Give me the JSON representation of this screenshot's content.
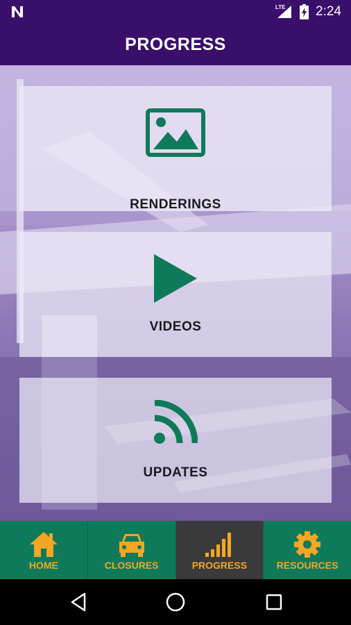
{
  "status_bar": {
    "network_label": "LTE",
    "time": "2:24"
  },
  "app_bar": {
    "title": "PROGRESS"
  },
  "cards": [
    {
      "label": "RENDERINGS",
      "icon": "image-icon"
    },
    {
      "label": "VIDEOS",
      "icon": "play-icon"
    },
    {
      "label": "UPDATES",
      "icon": "rss-icon"
    }
  ],
  "bottom_nav": {
    "items": [
      {
        "label": "HOME",
        "icon": "home-icon",
        "active": false
      },
      {
        "label": "CLOSURES",
        "icon": "car-icon",
        "active": false
      },
      {
        "label": "PROGRESS",
        "icon": "signal-bars-icon",
        "active": true
      },
      {
        "label": "RESOURCES",
        "icon": "gear-icon",
        "active": false
      }
    ]
  },
  "colors": {
    "header_purple": "#3a0f6b",
    "nav_green": "#0f7a5a",
    "icon_green": "#0f7a5a",
    "nav_label_orange": "#f5a623",
    "active_tab_bg": "#3a3a3a"
  }
}
